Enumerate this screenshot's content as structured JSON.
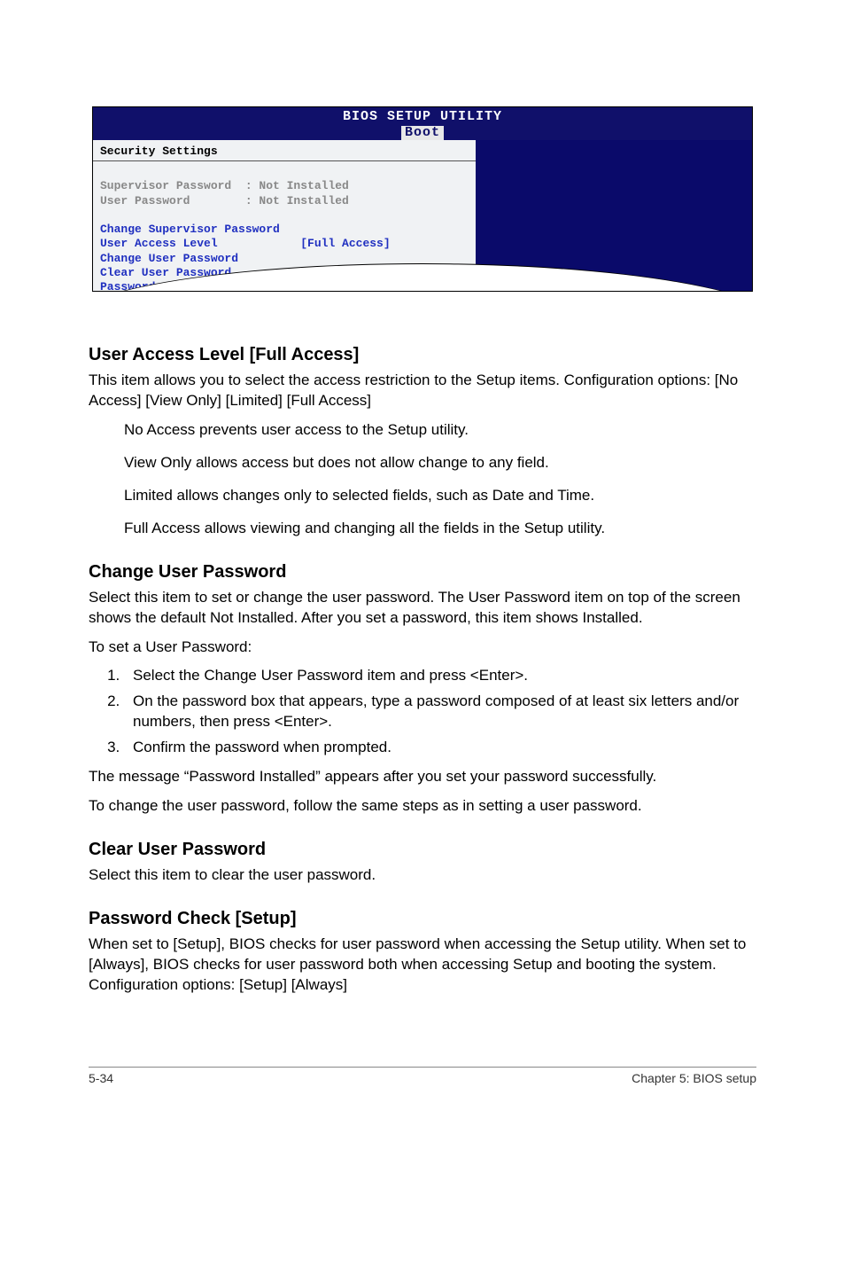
{
  "bios": {
    "title_top": "BIOS SETUP UTILITY",
    "tab": "Boot",
    "section_title": "Security Settings",
    "lines_gray": "Supervisor Password  : Not Installed\nUser Password        : Not Installed",
    "lines_blue": "Change Supervisor Password\nUser Access Level            [Full Access]\nChange User Password\nClear User Password\nPassword Check               [Setup]"
  },
  "s1": {
    "heading": "User Access Level [Full Access]",
    "p1": "This item allows you to select the access restriction to the Setup items. Configuration options: [No Access] [View Only] [Limited] [Full Access]",
    "b1": "No Access prevents user access to the Setup utility.",
    "b2": "View Only allows access but does not allow change to any field.",
    "b3": "Limited allows changes only to selected fields, such as Date and Time.",
    "b4": "Full Access allows viewing and changing all the fields in the Setup utility."
  },
  "s2": {
    "heading": "Change User Password",
    "p1": "Select this item to set or change the user password. The User Password item on top of the screen shows the default Not Installed. After you set a password, this item shows Installed.",
    "p2": "To set a User Password:",
    "li1": "Select the Change User Password item and press <Enter>.",
    "li2": "On the password box that appears, type a password composed of at least six letters and/or numbers, then press <Enter>.",
    "li3": "Confirm the password when prompted.",
    "p3": "The message “Password Installed” appears after you set your password successfully.",
    "p4": "To change the user password, follow the same steps as in setting a user password."
  },
  "s3": {
    "heading": "Clear User Password",
    "p1": "Select this item to clear the user password."
  },
  "s4": {
    "heading": "Password Check [Setup]",
    "p1": "When set to [Setup], BIOS checks for user password when accessing the Setup utility. When set to [Always], BIOS checks for user password both when accessing Setup and booting the system. Configuration options: [Setup] [Always]"
  },
  "footer": {
    "left": "5-34",
    "right": "Chapter 5: BIOS setup"
  }
}
